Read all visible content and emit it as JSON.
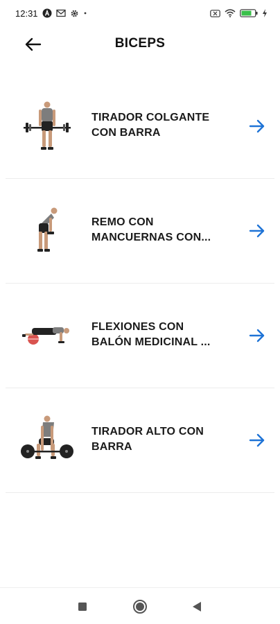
{
  "status_bar": {
    "time": "12:31",
    "icons": [
      "notification-a-icon",
      "mail-icon",
      "settings-gear-icon",
      "dot-icon",
      "sim-card-icon",
      "wifi-icon",
      "battery-icon",
      "charging-bolt-icon"
    ]
  },
  "header": {
    "title": "BICEPS",
    "back_icon": "arrow-left-icon"
  },
  "exercises": [
    {
      "label": "TIRADOR COLGANTE CON BARRA",
      "line1": "TIRADOR COLGANTE",
      "line2": "CON BARRA",
      "image": "barbell-hang-pull-figure"
    },
    {
      "label": "REMO CON MANCUERNAS CON...",
      "line1": "REMO CON",
      "line2": "MANCUERNAS CON...",
      "image": "dumbbell-row-figure"
    },
    {
      "label": "FLEXIONES CON BALÓN MEDICINAL ...",
      "line1": "FLEXIONES CON",
      "line2": "BALÓN MEDICINAL ...",
      "image": "medicine-ball-pushup-figure"
    },
    {
      "label": "TIRADOR ALTO CON BARRA",
      "line1": "TIRADOR ALTO CON",
      "line2": "BARRA",
      "image": "barbell-high-pull-figure"
    }
  ],
  "colors": {
    "accent": "#1e73d6",
    "text": "#1a1a1a",
    "background": "#ffffff"
  },
  "nav_bar": {
    "icons": [
      "recents-square-icon",
      "home-circle-icon",
      "back-triangle-icon"
    ]
  }
}
